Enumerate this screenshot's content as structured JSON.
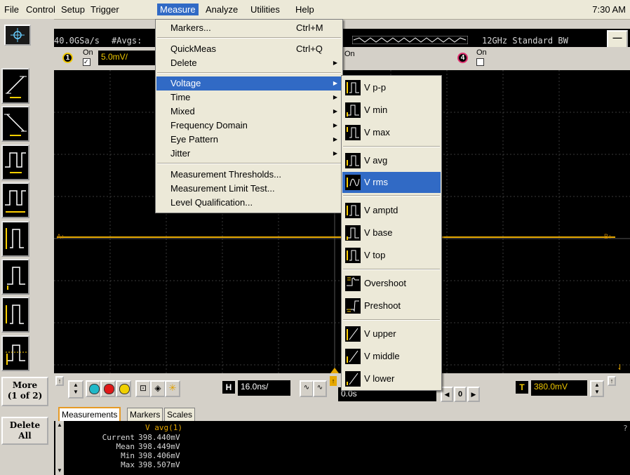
{
  "menubar": {
    "items": [
      "File",
      "Control",
      "Setup",
      "Trigger",
      "Measure",
      "Analyze",
      "Utilities",
      "Help"
    ],
    "active_index": 4,
    "clock": "7:30 AM"
  },
  "acquisition": {
    "sample_rate": "40.0GSa/s",
    "avgs_label": "#Avgs:",
    "bandwidth": "12GHz Standard BW"
  },
  "channels": {
    "ch1_number": "1",
    "ch1_on": "On",
    "ch1_scale": "5.0mV/",
    "ch3_on": "On",
    "ch4_number": "4",
    "ch4_on": "On"
  },
  "markers": {
    "left": "A↑",
    "right": "B↑"
  },
  "left_toolbar": {
    "more_line1": "More",
    "more_line2": "(1 of 2)",
    "delete_line1": "Delete",
    "delete_line2": "All"
  },
  "controls": {
    "h_label": "H",
    "timebase": "16.0ns/",
    "delay": "0.0s",
    "delay_step": "0",
    "t_label": "T",
    "trigger_level": "380.0mV"
  },
  "measurement_tabs": [
    "Measurements",
    "Markers",
    "Scales"
  ],
  "measurement_table": {
    "title": "V avg(1)",
    "rows": [
      {
        "label": "Current",
        "value": "398.440mV"
      },
      {
        "label": "Mean",
        "value": "398.449mV"
      },
      {
        "label": "Min",
        "value": "398.406mV"
      },
      {
        "label": "Max",
        "value": "398.507mV"
      }
    ],
    "help": "?"
  },
  "measure_menu": {
    "items": [
      {
        "label": "Markers...",
        "shortcut": "Ctrl+M"
      },
      {
        "label": "QuickMeas",
        "shortcut": "Ctrl+Q"
      },
      {
        "label": "Delete",
        "shortcut": ""
      },
      {
        "label": "Voltage",
        "shortcut": ""
      },
      {
        "label": "Time",
        "shortcut": ""
      },
      {
        "label": "Mixed",
        "shortcut": ""
      },
      {
        "label": "Frequency Domain",
        "shortcut": ""
      },
      {
        "label": "Eye Pattern",
        "shortcut": ""
      },
      {
        "label": "Jitter",
        "shortcut": ""
      },
      {
        "label": "Measurement Thresholds...",
        "shortcut": ""
      },
      {
        "label": "Measurement Limit Test...",
        "shortcut": ""
      },
      {
        "label": "Level Qualification...",
        "shortcut": ""
      }
    ]
  },
  "voltage_submenu": {
    "items": [
      "V p-p",
      "V min",
      "V max",
      "V avg",
      "V rms",
      "V amptd",
      "V base",
      "V top",
      "Overshoot",
      "Preshoot",
      "V upper",
      "V middle",
      "V lower"
    ]
  },
  "colors": {
    "menu_highlight": "#316ac5",
    "waveform": "#e6a800",
    "ch1_yellow": "#f0c800",
    "tab_accent": "#e69a26"
  }
}
